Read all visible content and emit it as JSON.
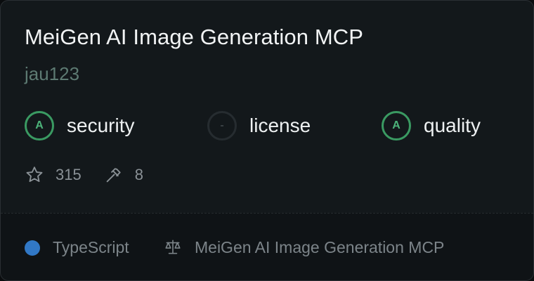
{
  "card": {
    "title": "MeiGen AI Image Generation MCP",
    "author": "jau123"
  },
  "grades": [
    {
      "label": "security",
      "grade": "A"
    },
    {
      "label": "license",
      "grade": "-"
    },
    {
      "label": "quality",
      "grade": "A"
    }
  ],
  "stats": {
    "stars": "315",
    "tools": "8"
  },
  "footer": {
    "language": "TypeScript",
    "language_color": "#3178c6",
    "license": "MeiGen AI Image Generation MCP"
  },
  "colors": {
    "grade_a": "#3a9a62",
    "background": "#13181b"
  }
}
